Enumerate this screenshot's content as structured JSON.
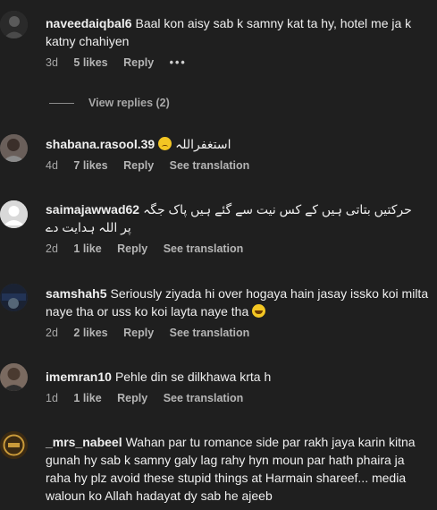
{
  "comments": [
    {
      "username": "naveedaiqbal6",
      "text": "Baal kon aisy sab k samny kat ta hy, hotel me ja k katny chahiyen",
      "time": "3d",
      "likes": "5 likes",
      "reply": "Reply",
      "more": "•••",
      "view_replies": "View replies (2)"
    },
    {
      "username": "shabana.rasool.39",
      "text": "استغفراللہ",
      "time": "4d",
      "likes": "7 likes",
      "reply": "Reply",
      "see_translation": "See translation"
    },
    {
      "username": "saimajawwad62",
      "text_rtl_line1": "حرکتیں بتاتی ہیں کے کس نیت سے گئے ہیں پاک جگہ",
      "text_rtl_line2": "پر اللہ ہدایت دے",
      "time": "2d",
      "likes": "1 like",
      "reply": "Reply",
      "see_translation": "See translation"
    },
    {
      "username": "samshah5",
      "text": "Seriously ziyada hi over hogaya hain jasay issko koi milta naye tha or uss ko koi layta naye tha",
      "time": "2d",
      "likes": "2 likes",
      "reply": "Reply",
      "see_translation": "See translation"
    },
    {
      "username": "imemran10",
      "text": "Pehle din se dilkhawa krta h",
      "time": "1d",
      "likes": "1 like",
      "reply": "Reply",
      "see_translation": "See translation"
    },
    {
      "username": "_mrs_nabeel",
      "text": "Wahan par tu romance side par rakh jaya karin kitna gunah hy sab k samny galy lag rahy hyn moun par hath phaira ja raha hy plz avoid these stupid things at Harmain shareef... media waloun ko Allah hadayat dy sab he ajeeb"
    }
  ]
}
